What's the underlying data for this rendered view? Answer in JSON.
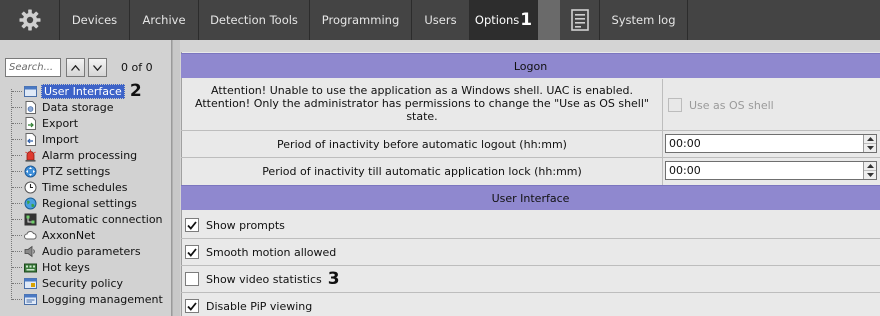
{
  "topbar": {
    "settings_icon": "gear-icon",
    "tabs": [
      {
        "label": "Devices",
        "active": false
      },
      {
        "label": "Archive",
        "active": false
      },
      {
        "label": "Detection Tools",
        "active": false
      },
      {
        "label": "Programming",
        "active": false
      },
      {
        "label": "Users",
        "active": false
      },
      {
        "label": "Options",
        "active": true
      }
    ],
    "options_marker": "1",
    "system_log_icon": "document-icon",
    "system_log_label": "System log"
  },
  "sidebar": {
    "search_placeholder": "Search...",
    "up_icon": "arrow-up-icon",
    "down_icon": "arrow-down-icon",
    "count": "0 of 0",
    "items": [
      {
        "label": "User Interface",
        "icon": "ui-window-icon",
        "selected": true,
        "marker": "2"
      },
      {
        "label": "Data storage",
        "icon": "data-storage-icon"
      },
      {
        "label": "Export",
        "icon": "export-icon"
      },
      {
        "label": "Import",
        "icon": "import-icon"
      },
      {
        "label": "Alarm processing",
        "icon": "alarm-icon"
      },
      {
        "label": "PTZ settings",
        "icon": "ptz-icon"
      },
      {
        "label": "Time schedules",
        "icon": "clock-icon"
      },
      {
        "label": "Regional settings",
        "icon": "globe-icon"
      },
      {
        "label": "Automatic connection",
        "icon": "connection-icon"
      },
      {
        "label": "AxxonNet",
        "icon": "cloud-icon"
      },
      {
        "label": "Audio parameters",
        "icon": "speaker-icon"
      },
      {
        "label": "Hot keys",
        "icon": "keyboard-icon"
      },
      {
        "label": "Security policy",
        "icon": "security-icon"
      },
      {
        "label": "Logging management",
        "icon": "logging-icon"
      }
    ]
  },
  "logon": {
    "header": "Logon",
    "attention_text": "Attention! Unable to use the application as a Windows shell. UAC is enabled. Attention! Only the administrator has permissions to change the \"Use as OS shell\" state.",
    "attention_line1": "Attention! Unable to use the application as a Windows shell. UAC is enabled.",
    "attention_line2": "Attention! Only the administrator has permissions to change the \"Use as OS shell\"",
    "attention_line3": "state.",
    "use_as_shell_label": "Use as OS shell",
    "use_as_shell_checked": false,
    "use_as_shell_enabled": false,
    "logout_label": "Period of inactivity before automatic logout (hh:mm)",
    "logout_value": "00:00",
    "lock_label": "Period of inactivity till automatic application lock (hh:mm)",
    "lock_value": "00:00"
  },
  "user_interface": {
    "header": "User Interface",
    "options": [
      {
        "label": "Show prompts",
        "checked": true
      },
      {
        "label": "Smooth motion allowed",
        "checked": true
      },
      {
        "label": "Show video statistics",
        "checked": false,
        "marker": "3"
      },
      {
        "label": "Disable PiP viewing",
        "checked": true
      }
    ]
  }
}
